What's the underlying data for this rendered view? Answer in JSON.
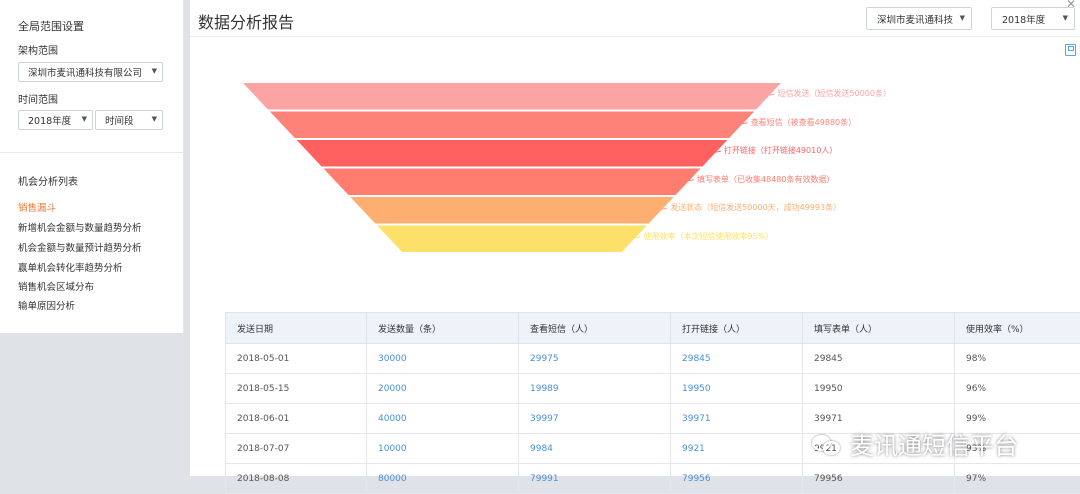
{
  "sidebar": {
    "global_title": "全局范围设置",
    "org_label": "架构范围",
    "org_value": "深圳市麦讯通科技有限公司",
    "time_label": "时间范围",
    "year_value": "2018年度",
    "period_value": "时间段",
    "list_title": "机会分析列表",
    "items": [
      {
        "label": "销售漏斗",
        "active": true
      },
      {
        "label": "新增机会金额与数量趋势分析"
      },
      {
        "label": "机会金额与数量预计趋势分析"
      },
      {
        "label": "赢单机会转化率趋势分析"
      },
      {
        "label": "销售机会区域分布"
      },
      {
        "label": "输单原因分析"
      }
    ]
  },
  "header": {
    "title": "数据分析报告",
    "company_select": "深圳市麦讯通科技",
    "year_select": "2018年度",
    "close_icon": "close-icon",
    "save_icon": "save-icon"
  },
  "chart_data": {
    "type": "funnel",
    "stages": [
      {
        "label": "短信发送（短信发送50000条）",
        "color": "#fca4a3"
      },
      {
        "label": "查看短信（被查看49880条）",
        "color": "#fd8378"
      },
      {
        "label": "打开链接（打开链接49010人）",
        "color": "#ff6161"
      },
      {
        "label": "填写表单（已收集48480条有效数据）",
        "color": "#fe7d6f"
      },
      {
        "label": "发送状态（短信发送50000天，成功49993条）",
        "color": "#feae70"
      },
      {
        "label": "使用效率（本次短信使用效率95%）",
        "color": "#fde06a"
      }
    ]
  },
  "table": {
    "headers": [
      "发送日期",
      "发送数量（条）",
      "查看短信（人）",
      "打开链接（人）",
      "填写表单（人）",
      "使用效率（%）"
    ],
    "rows": [
      [
        "2018-05-01",
        "30000",
        "29975",
        "29845",
        "29845",
        "98%"
      ],
      [
        "2018-05-15",
        "20000",
        "19989",
        "19950",
        "19950",
        "96%"
      ],
      [
        "2018-06-01",
        "40000",
        "39997",
        "39971",
        "39971",
        "99%"
      ],
      [
        "2018-07-07",
        "10000",
        "9984",
        "9921",
        "9921",
        "93%"
      ],
      [
        "2018-08-08",
        "80000",
        "79991",
        "79956",
        "79956",
        "97%"
      ]
    ]
  },
  "watermark": {
    "text": "麦讯通短信平台",
    "icon": "wechat-icon"
  }
}
